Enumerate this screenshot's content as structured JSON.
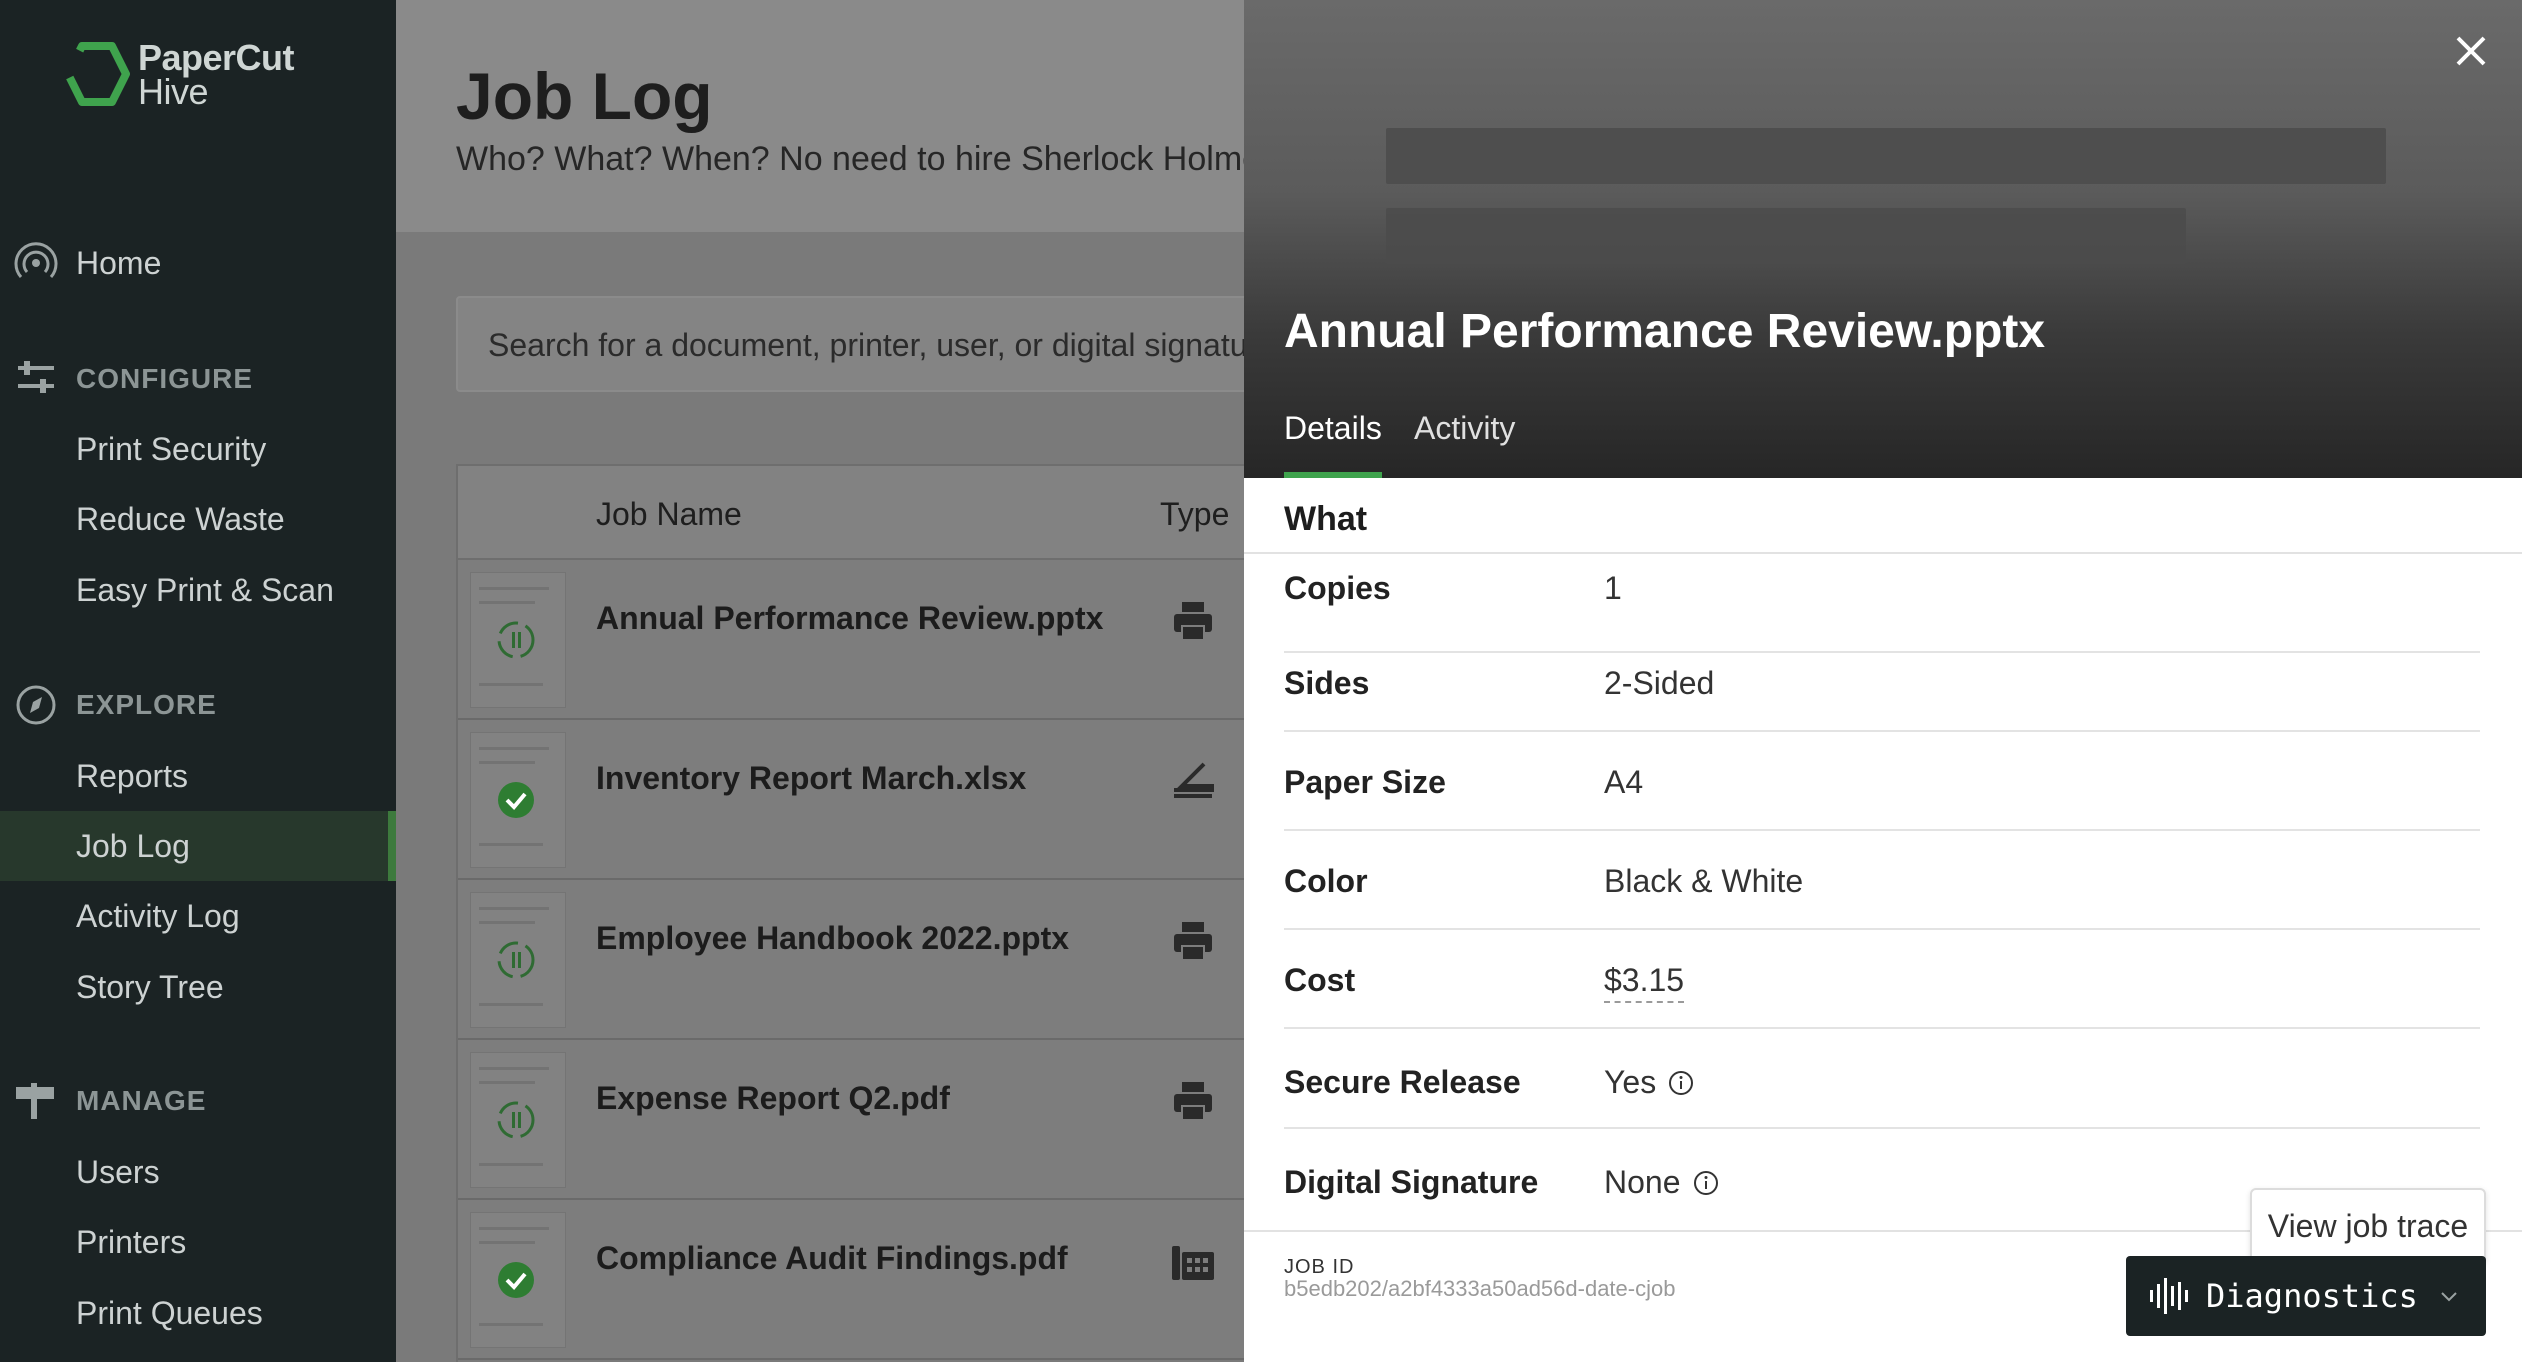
{
  "brand": {
    "line1": "PaperCut",
    "line2": "Hive",
    "accent": "#3fa34d"
  },
  "sidebar": {
    "home": "Home",
    "configure": {
      "heading": "CONFIGURE",
      "items": [
        "Print Security",
        "Reduce Waste",
        "Easy Print & Scan"
      ]
    },
    "explore": {
      "heading": "EXPLORE",
      "items": [
        "Reports",
        "Job Log",
        "Activity Log",
        "Story Tree"
      ],
      "active": "Job Log"
    },
    "manage": {
      "heading": "MANAGE",
      "items": [
        "Users",
        "Printers",
        "Print Queues"
      ]
    }
  },
  "main": {
    "title": "Job Log",
    "subtitle": "Who? What? When? No need to hire Sherlock Holmes",
    "search_placeholder": "Search for a document, printer, user, or digital signature",
    "columns": {
      "job_name": "Job Name",
      "type": "Type"
    },
    "rows": [
      {
        "name": "Annual Performance Review.pptx",
        "status_icon": "hourglass-icon",
        "type_icon": "printer-icon"
      },
      {
        "name": "Inventory Report March.xlsx",
        "status_icon": "check-circle-icon",
        "type_icon": "scanner-icon"
      },
      {
        "name": "Employee Handbook 2022.pptx",
        "status_icon": "hourglass-icon",
        "type_icon": "printer-icon"
      },
      {
        "name": "Expense Report Q2.pdf",
        "status_icon": "hourglass-icon",
        "type_icon": "printer-icon"
      },
      {
        "name": "Compliance Audit Findings.pdf",
        "status_icon": "check-circle-icon",
        "type_icon": "fax-icon"
      }
    ]
  },
  "panel": {
    "title": "Annual Performance Review.pptx",
    "tabs": {
      "details": "Details",
      "activity": "Activity"
    },
    "section": "What",
    "details": {
      "copies": {
        "label": "Copies",
        "value": "1"
      },
      "sides": {
        "label": "Sides",
        "value": "2-Sided"
      },
      "paper_size": {
        "label": "Paper Size",
        "value": "A4"
      },
      "color": {
        "label": "Color",
        "value": "Black & White"
      },
      "cost": {
        "label": "Cost",
        "value": "$3.15"
      },
      "secure_release": {
        "label": "Secure Release",
        "value": "Yes"
      },
      "digital_signature": {
        "label": "Digital Signature",
        "value": "None"
      }
    },
    "job_id_label": "JOB ID",
    "job_id": "b5edb202/a2bf4333a50ad56d-date-cjob",
    "tooltip": "View job trace",
    "diagnostics": "Diagnostics"
  }
}
